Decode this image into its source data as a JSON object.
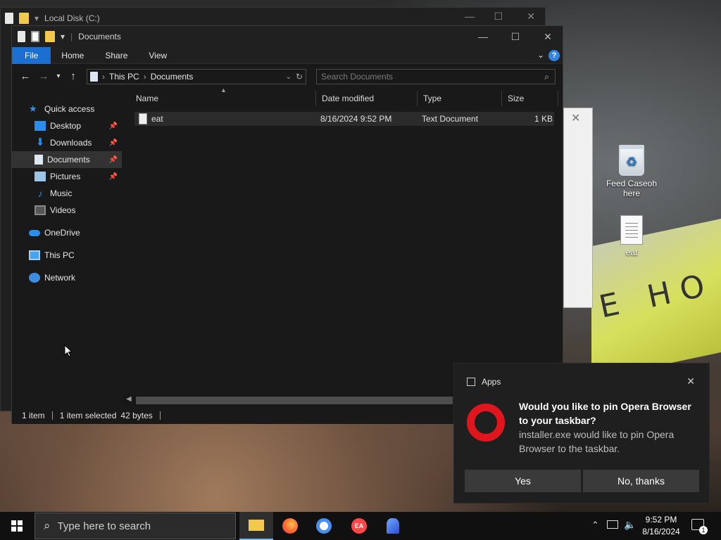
{
  "back_window": {
    "title": "Local Disk (C:)"
  },
  "window": {
    "title": "Documents",
    "ribbon_tabs": [
      "File",
      "Home",
      "Share",
      "View"
    ],
    "address": {
      "segments": [
        "This PC",
        "Documents"
      ]
    },
    "search": {
      "placeholder": "Search Documents"
    },
    "nav_items": [
      {
        "label": "Quick access",
        "icon": "star-icon"
      },
      {
        "label": "Desktop",
        "icon": "desktop-icon",
        "pinned": true
      },
      {
        "label": "Downloads",
        "icon": "download-icon",
        "pinned": true
      },
      {
        "label": "Documents",
        "icon": "documents-icon",
        "pinned": true,
        "selected": true
      },
      {
        "label": "Pictures",
        "icon": "pictures-icon",
        "pinned": true
      },
      {
        "label": "Music",
        "icon": "music-icon"
      },
      {
        "label": "Videos",
        "icon": "videos-icon"
      },
      {
        "label": "OneDrive",
        "icon": "cloud-icon"
      },
      {
        "label": "This PC",
        "icon": "pc-icon"
      },
      {
        "label": "Network",
        "icon": "network-icon"
      }
    ],
    "columns": [
      "Name",
      "Date modified",
      "Type",
      "Size"
    ],
    "files": [
      {
        "name": "eat",
        "date": "8/16/2024 9:52 PM",
        "type": "Text Document",
        "size": "1 KB"
      }
    ],
    "status": {
      "count": "1 item",
      "selected": "1 item selected",
      "size": "42 bytes"
    }
  },
  "desktop": {
    "icons": [
      {
        "label": "Feed Caseoh here",
        "icon": "recycle-bin-icon"
      },
      {
        "label": "eat",
        "icon": "text-file-icon"
      }
    ],
    "sign_text": "E HO"
  },
  "toast": {
    "app": "Apps",
    "title": "Would you like to pin Opera Browser to your taskbar?",
    "body": "installer.exe would like to pin Opera Browser to the taskbar.",
    "yes": "Yes",
    "no": "No, thanks"
  },
  "taskbar": {
    "search_placeholder": "Type here to search",
    "time": "9:52 PM",
    "date": "8/16/2024",
    "notif_count": "1"
  },
  "colors": {
    "accent": "#1a6fd0",
    "opera_red": "#e0161f",
    "toast_bg": "#1f1f1f"
  }
}
